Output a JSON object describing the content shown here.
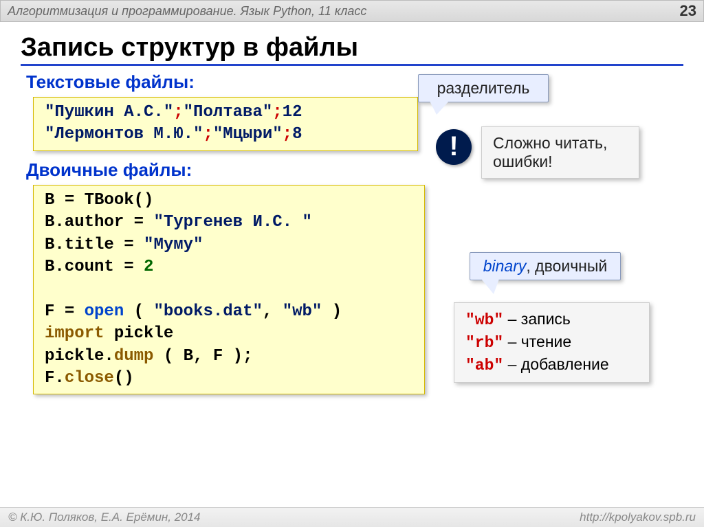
{
  "header": {
    "course": "Алгоритмизация и программирование. Язык Python, 11 класс",
    "page": "23"
  },
  "title": "Запись структур в файлы",
  "textfiles": {
    "heading": "Текстовые файлы:",
    "line1_a": "\"Пушкин А.С.\"",
    "line1_b": "\"Полтава\"",
    "line1_c": "12",
    "line2_a": "\"Лермонтов М.Ю.\"",
    "line2_b": "\"Мцыри\"",
    "line2_c": "8",
    "semicolon": ";"
  },
  "callout_sep": "разделитель",
  "badge_text": "!",
  "warning": "Сложно читать, ошибки!",
  "binfiles": {
    "heading": "Двоичные файлы:",
    "l1a": "B",
    "l1b": "=",
    "l1c": "TBook()",
    "l2a": "B.author",
    "l2b": "=",
    "l2c": "\"Тургенев И.С. \"",
    "l3a": "B.title",
    "l3b": "=",
    "l3c": "\"Муму\"",
    "l4a": "B.count",
    "l4b": "=",
    "l4c": "2",
    "l5a": "F",
    "l5b": "=",
    "l5c": "open",
    "l5d": "( ",
    "l5e": "\"books.dat\"",
    "l5f": ", ",
    "l5g": "\"wb\"",
    "l5h": " )",
    "l6a": "import",
    "l6b": " pickle",
    "l7a": "pickle.",
    "l7b": "dump",
    "l7c": "( B, F );",
    "l8a": "F.",
    "l8b": "close",
    "l8c": "()"
  },
  "callout_bin_a": "binary",
  "callout_bin_b": ", двоичный",
  "modes": {
    "wb": "\"wb\"",
    "wb_t": " – запись",
    "rb": "\"rb\"",
    "rb_t": " – чтение",
    "ab": "\"ab\"",
    "ab_t": " – добавление"
  },
  "footer": {
    "left": "© К.Ю. Поляков, Е.А. Ерёмин, 2014",
    "right": "http://kpolyakov.spb.ru"
  }
}
